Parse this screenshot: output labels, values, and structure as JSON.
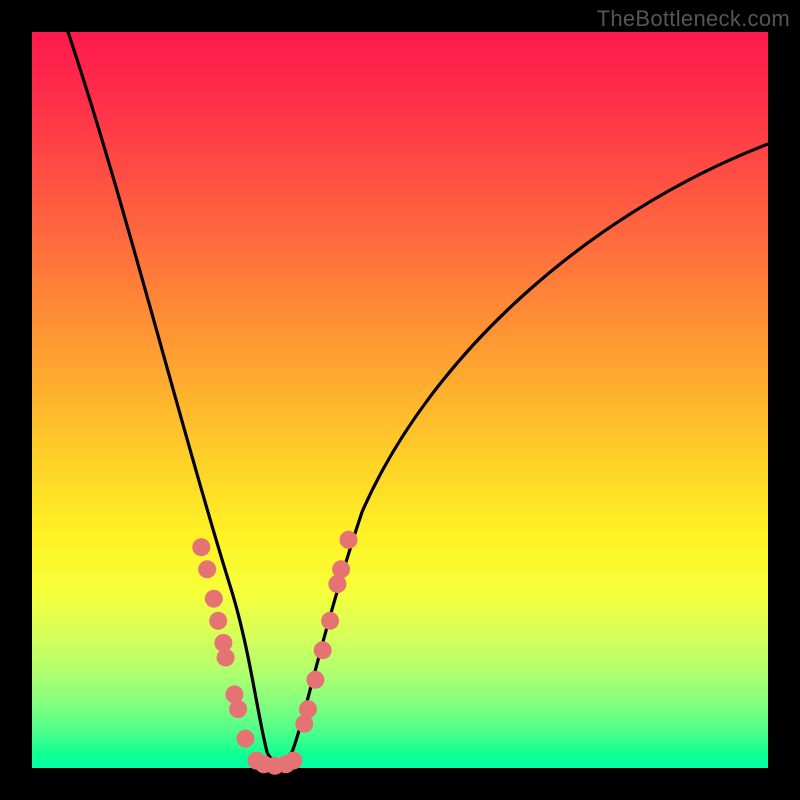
{
  "watermark": "TheBottleneck.com",
  "chart_data": {
    "type": "line",
    "title": "",
    "xlabel": "",
    "ylabel": "",
    "xlim": [
      0,
      100
    ],
    "ylim": [
      0,
      100
    ],
    "series": [
      {
        "name": "curve-left",
        "x": [
          5,
          8,
          12,
          16,
          19,
          22,
          24,
          26,
          27,
          28,
          29,
          30,
          31
        ],
        "y": [
          100,
          86,
          70,
          53,
          40,
          30,
          22,
          15,
          10,
          6,
          3,
          1,
          0
        ]
      },
      {
        "name": "curve-right",
        "x": [
          35,
          36,
          37,
          38,
          40,
          44,
          50,
          58,
          68,
          80,
          92,
          100
        ],
        "y": [
          0,
          1,
          3,
          6,
          12,
          24,
          40,
          55,
          67,
          76,
          82,
          85
        ]
      }
    ],
    "markers": {
      "name": "highlight-dots",
      "color": "#e57373",
      "points": [
        {
          "x": 23.0,
          "y": 30.0
        },
        {
          "x": 23.8,
          "y": 27.0
        },
        {
          "x": 24.7,
          "y": 23.0
        },
        {
          "x": 25.3,
          "y": 20.0
        },
        {
          "x": 26.0,
          "y": 17.0
        },
        {
          "x": 26.3,
          "y": 15.0
        },
        {
          "x": 27.5,
          "y": 10.0
        },
        {
          "x": 28.0,
          "y": 8.0
        },
        {
          "x": 29.0,
          "y": 4.0
        },
        {
          "x": 30.5,
          "y": 1.0
        },
        {
          "x": 31.5,
          "y": 0.5
        },
        {
          "x": 33.0,
          "y": 0.3
        },
        {
          "x": 34.5,
          "y": 0.5
        },
        {
          "x": 35.5,
          "y": 1.0
        },
        {
          "x": 37.0,
          "y": 6.0
        },
        {
          "x": 37.5,
          "y": 8.0
        },
        {
          "x": 38.5,
          "y": 12.0
        },
        {
          "x": 39.5,
          "y": 16.0
        },
        {
          "x": 40.5,
          "y": 20.0
        },
        {
          "x": 41.5,
          "y": 25.0
        },
        {
          "x": 42.0,
          "y": 27.0
        },
        {
          "x": 43.0,
          "y": 31.0
        }
      ]
    }
  }
}
